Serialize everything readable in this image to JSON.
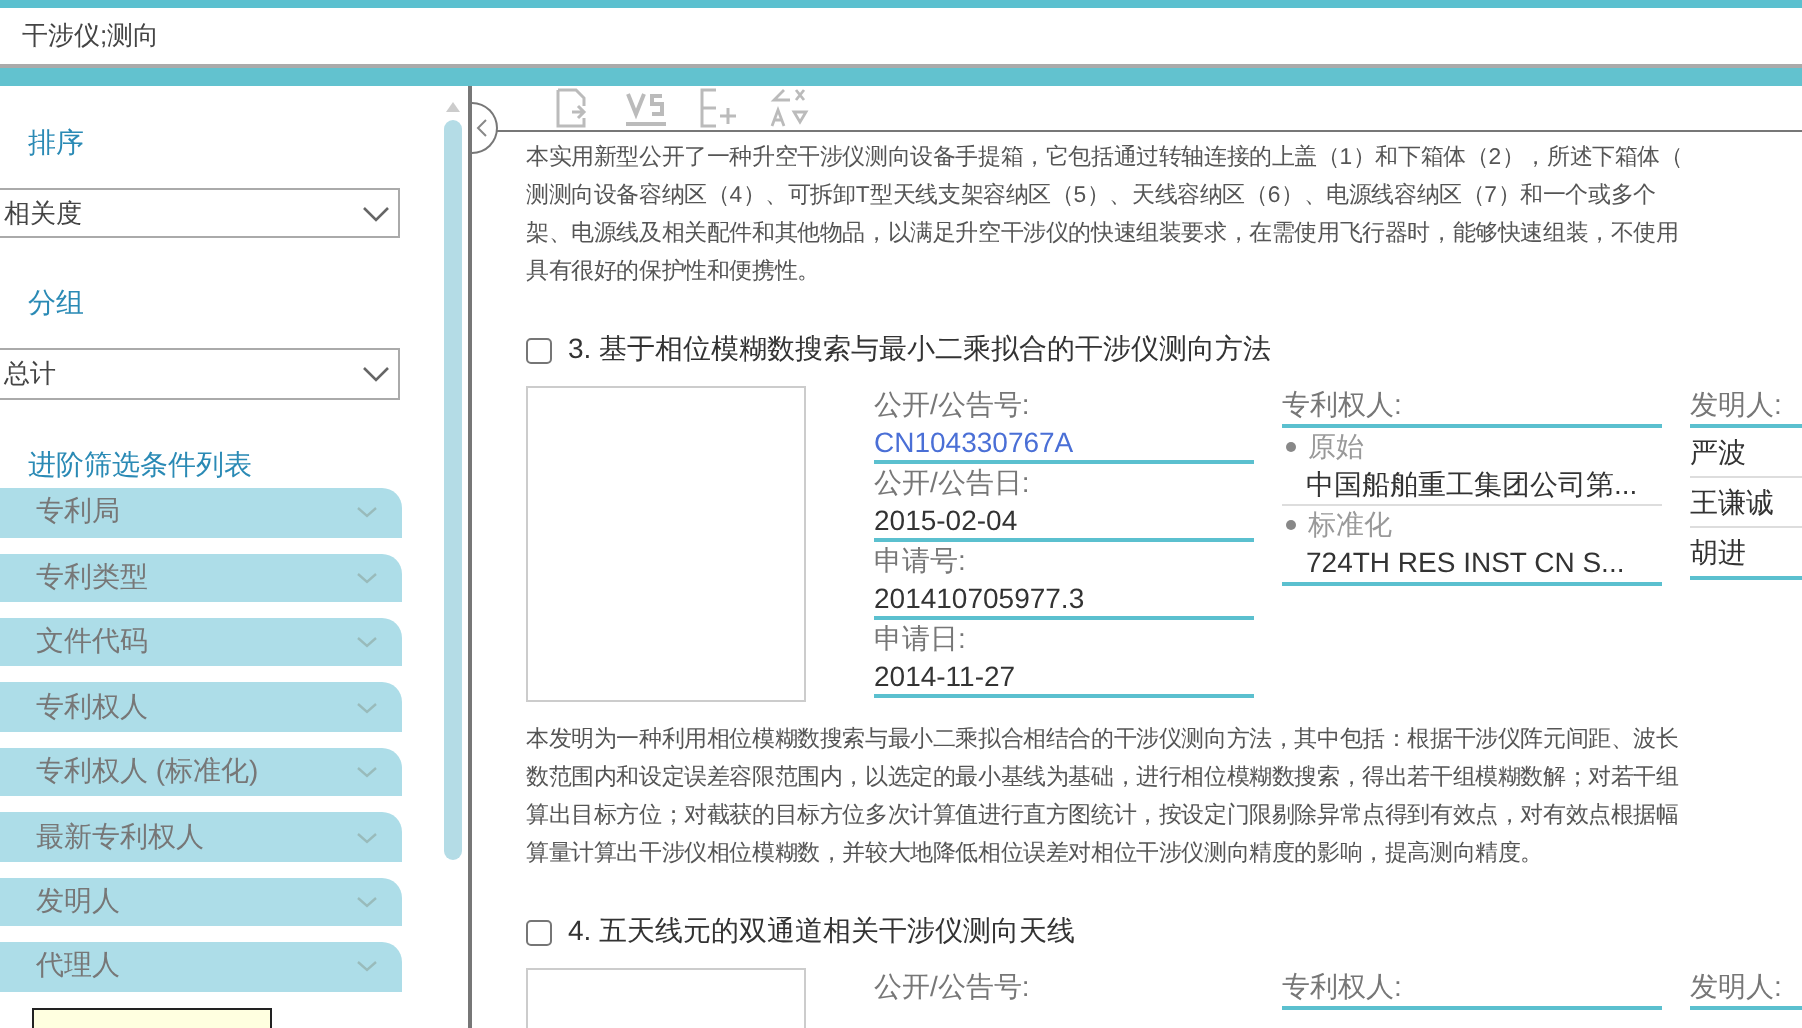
{
  "search": {
    "value": "干涉仪;测向"
  },
  "sidebar": {
    "sort_label": "排序",
    "sort_value": "相关度",
    "group_label": "分组",
    "group_value": "总计",
    "filter_title": "进阶筛选条件列表",
    "filters": [
      {
        "label": "专利局"
      },
      {
        "label": "专利类型"
      },
      {
        "label": "文件代码"
      },
      {
        "label": "专利权人"
      },
      {
        "label": "专利权人 (标准化)"
      },
      {
        "label": "最新专利权人"
      },
      {
        "label": "发明人"
      },
      {
        "label": "代理人"
      }
    ]
  },
  "previous_abstract": [
    "本实用新型公开了一种升空干涉仪测向设备手提箱，它包括通过转轴连接的上盖（1）和下箱体（2），所述下箱体（",
    "测测向设备容纳区（4）、可拆卸T型天线支架容纳区（5）、天线容纳区（6）、电源线容纳区（7）和一个或多个",
    "架、电源线及相关配件和其他物品，以满足升空干涉仪的快速组装要求，在需使用飞行器时，能够快速组装，不使用",
    "具有很好的保护性和便携性。"
  ],
  "results": [
    {
      "number": "3.",
      "title": "基于相位模糊数搜索与最小二乘拟合的干涉仪测向方法",
      "checked": false,
      "fields": [
        {
          "label": "公开/公告号:",
          "value": "CN104330767A",
          "kind": "link"
        },
        {
          "label": "公开/公告日:",
          "value": "2015-02-04",
          "kind": "text"
        },
        {
          "label": "申请号:",
          "value": "201410705977.3",
          "kind": "text"
        },
        {
          "label": "申请日:",
          "value": "2014-11-27",
          "kind": "text"
        }
      ],
      "assignee_label": "专利权人:",
      "assignees": [
        {
          "label": "原始",
          "value": "中国船舶重工集团公司第..."
        },
        {
          "label": "标准化",
          "value": "724TH RES INST CN S..."
        }
      ],
      "inventor_label": "发明人:",
      "inventors": [
        "严波",
        "王谦诚",
        "胡进"
      ],
      "abstract": [
        "本发明为一种利用相位模糊数搜索与最小二乘拟合相结合的干涉仪测向方法，其中包括：根据干涉仪阵元间距、波长",
        "数范围内和设定误差容限范围内，以选定的最小基线为基础，进行相位模糊数搜索，得出若干组模糊数解；对若干组",
        "算出目标方位；对截获的目标方位多次计算值进行直方图统计，按设定门限剔除异常点得到有效点，对有效点根据幅",
        "算量计算出干涉仪相位模糊数，并较大地降低相位误差对相位干涉仪测向精度的影响，提高测向精度。"
      ]
    },
    {
      "number": "4.",
      "title": "五天线元的双通道相关干涉仪测向天线",
      "checked": false,
      "fields": [
        {
          "label": "公开/公告号:"
        }
      ],
      "assignee_label": "专利权人:",
      "inventor_label": "发明人:"
    }
  ]
}
